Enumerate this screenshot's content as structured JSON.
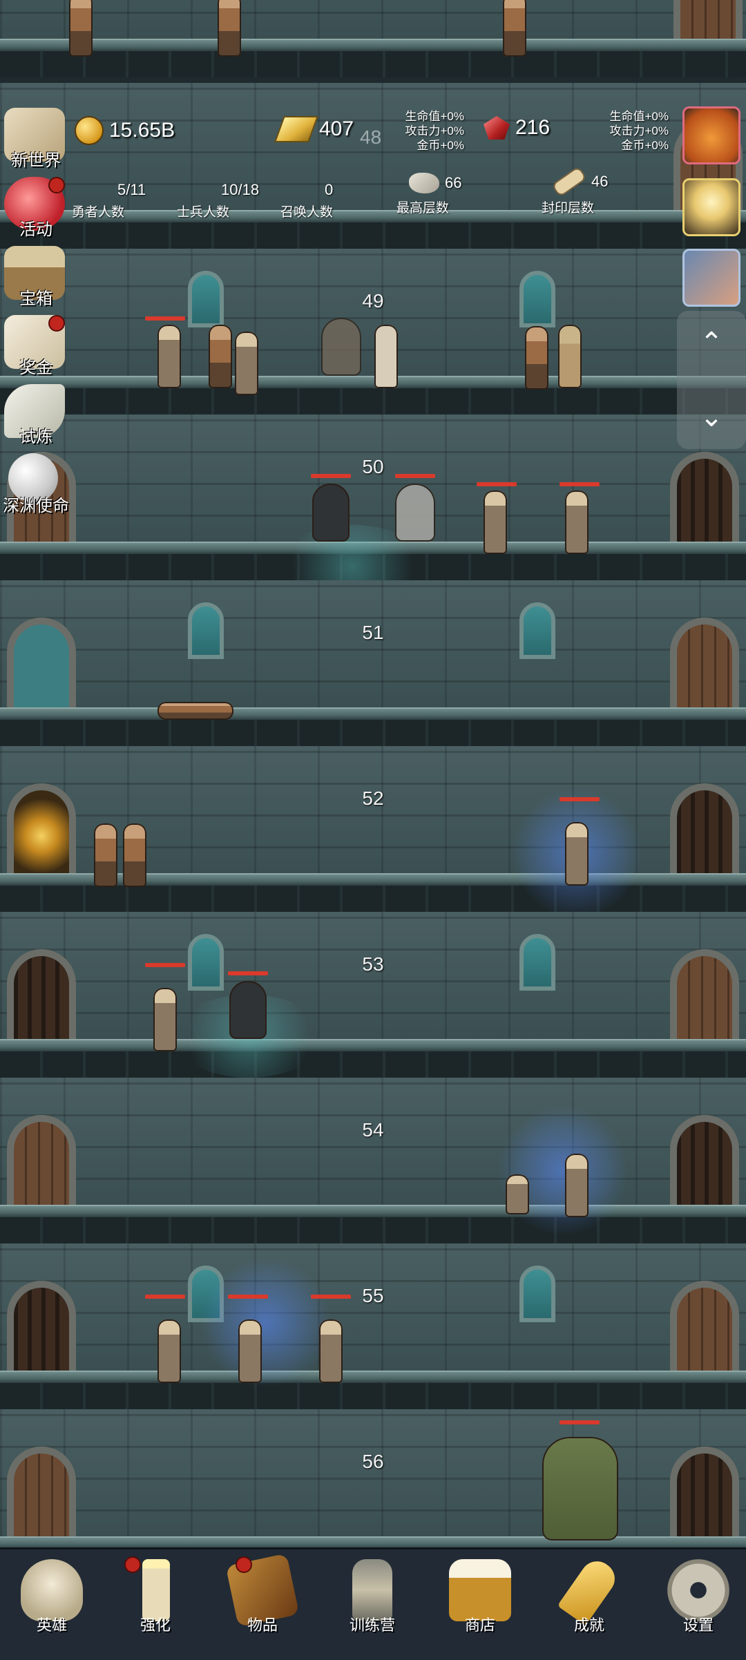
{
  "hud": {
    "gold": "15.65B",
    "gold_bars": "407",
    "ghost_floor": "48",
    "gems": "216",
    "bonus_left": [
      "生命值+0%",
      "攻击力+0%",
      "金币+0%"
    ],
    "bonus_right": [
      "生命值+0%",
      "攻击力+0%",
      "金币+0%"
    ],
    "hero_count": "5/11",
    "hero_label": "勇者人数",
    "soldier_count": "10/18",
    "soldier_label": "士兵人数",
    "summon_count": "0",
    "summon_label": "召唤人数",
    "max_floor": "66",
    "max_floor_label": "最高层数",
    "seal_floor": "46",
    "seal_floor_label": "封印层数"
  },
  "side_menu": [
    {
      "label": "新世界",
      "icon": "map-scroll-icon",
      "badge": false
    },
    {
      "label": "活动",
      "icon": "heart-icon",
      "badge": true
    },
    {
      "label": "宝箱",
      "icon": "treasure-chest-icon",
      "badge": false
    },
    {
      "label": "奖金",
      "icon": "envelope-icon",
      "badge": true
    },
    {
      "label": "试炼",
      "icon": "feather-icon",
      "badge": false
    },
    {
      "label": "深渊使命",
      "icon": "pearl-icon",
      "badge": false
    }
  ],
  "right_buttons": [
    "pumpkin-icon",
    "candle-icon",
    "treasure-map-icon"
  ],
  "floors": [
    "49",
    "50",
    "51",
    "52",
    "53",
    "54",
    "55",
    "56"
  ],
  "nav": [
    {
      "label": "英雄",
      "icon": "skull-icon",
      "badge": false
    },
    {
      "label": "强化",
      "icon": "candle-icon",
      "badge": true
    },
    {
      "label": "物品",
      "icon": "book-icon",
      "badge": true
    },
    {
      "label": "训练营",
      "icon": "lantern-icon",
      "badge": false
    },
    {
      "label": "商店",
      "icon": "beer-mug-icon",
      "badge": false
    },
    {
      "label": "成就",
      "icon": "key-icon",
      "badge": false
    },
    {
      "label": "设置",
      "icon": "gear-icon",
      "badge": false
    }
  ],
  "colors": {
    "hp_bar": "#d93a2b",
    "badge": "#c0261e",
    "nav_bg": "#222a35"
  }
}
